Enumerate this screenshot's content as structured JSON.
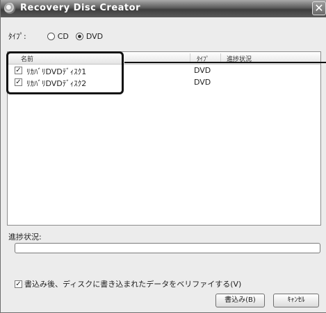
{
  "window": {
    "title": "Recovery Disc Creator",
    "close_glyph": "✕"
  },
  "type_row": {
    "label": "ﾀｲﾌﾟ:",
    "options": [
      {
        "label": "CD",
        "selected": false
      },
      {
        "label": "DVD",
        "selected": true
      }
    ]
  },
  "list": {
    "columns": [
      "名前",
      "ﾀｲﾌﾟ",
      "進捗状況"
    ],
    "rows": [
      {
        "name": "ﾘｶﾊﾞﾘDVDﾃﾞｨｽｸ1",
        "type": "DVD",
        "checked": true
      },
      {
        "name": "ﾘｶﾊﾞﾘDVDﾃﾞｨｽｸ2",
        "type": "DVD",
        "checked": true
      }
    ]
  },
  "progress": {
    "label": "進捗状況:",
    "value": 0
  },
  "verify": {
    "label": "書込み後、ディスクに書き込まれたデータをベリファイする(V)",
    "checked": true
  },
  "buttons": {
    "write": "書込み(B)",
    "cancel": "ｷｬﾝｾﾙ"
  },
  "icons": {
    "title_icon": "disc-icon",
    "check_glyph": "✓"
  }
}
